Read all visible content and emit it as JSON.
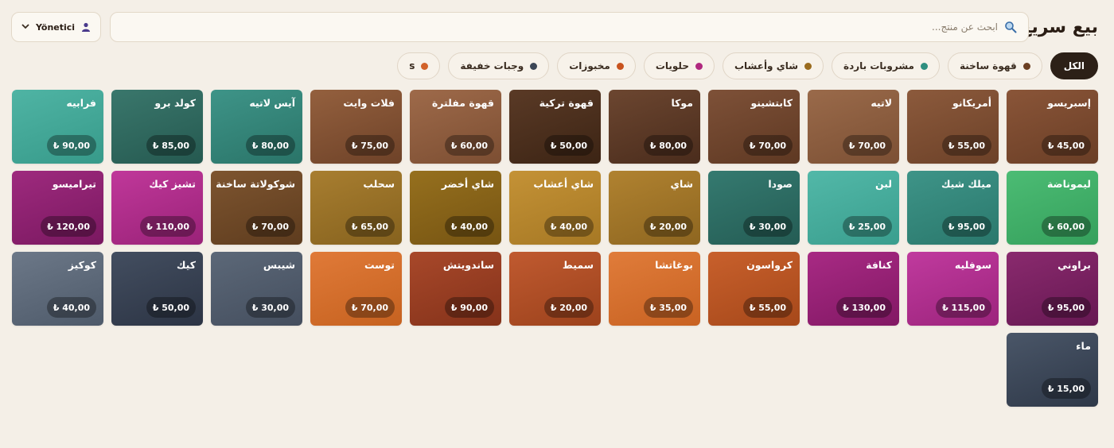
{
  "header": {
    "title": "بيع سريع",
    "search_placeholder": "ابحث عن منتج...",
    "user_label": "Yönetici"
  },
  "categories": [
    {
      "label": "الكل",
      "active": true,
      "color": ""
    },
    {
      "label": "قهوة ساخنة",
      "active": false,
      "color": "#6b3f22"
    },
    {
      "label": "مشروبات باردة",
      "active": false,
      "color": "#2f8f80"
    },
    {
      "label": "شاي وأعشاب",
      "active": false,
      "color": "#9a6b1e"
    },
    {
      "label": "حلويات",
      "active": false,
      "color": "#b0287f"
    },
    {
      "label": "مخبوزات",
      "active": false,
      "color": "#c8531f"
    },
    {
      "label": "وجبات خفيفة",
      "active": false,
      "color": "#3c4656"
    },
    {
      "label": "s",
      "active": false,
      "color": "#d2622a"
    }
  ],
  "products": [
    {
      "name": "إسبريسو",
      "price": "₺ 45,00",
      "c1": "#8a5538",
      "c2": "#6a3e26"
    },
    {
      "name": "أمريكانو",
      "price": "₺ 55,00",
      "c1": "#8c5a3c",
      "c2": "#6c4128"
    },
    {
      "name": "لاتيه",
      "price": "₺ 70,00",
      "c1": "#9a6a4a",
      "c2": "#7c5034"
    },
    {
      "name": "كابتشينو",
      "price": "₺ 70,00",
      "c1": "#7e5138",
      "c2": "#5e3822"
    },
    {
      "name": "موكا",
      "price": "₺ 80,00",
      "c1": "#6c4630",
      "c2": "#4a2c1c"
    },
    {
      "name": "قهوة تركية",
      "price": "₺ 50,00",
      "c1": "#5a3a26",
      "c2": "#3c2414"
    },
    {
      "name": "قهوة مفلترة",
      "price": "₺ 60,00",
      "c1": "#9e6a4a",
      "c2": "#7c4e32"
    },
    {
      "name": "فلات وايت",
      "price": "₺ 75,00",
      "c1": "#94603e",
      "c2": "#6e4228"
    },
    {
      "name": "آيس لاتيه",
      "price": "₺ 80,00",
      "c1": "#3e9488",
      "c2": "#2a7468"
    },
    {
      "name": "كولد برو",
      "price": "₺ 85,00",
      "c1": "#3a776c",
      "c2": "#255950"
    },
    {
      "name": "فرابيه",
      "price": "₺ 90,00",
      "c1": "#4fb4a4",
      "c2": "#379a8a"
    },
    {
      "name": "ليموناضة",
      "price": "₺ 60,00",
      "c1": "#4cbc74",
      "c2": "#35a05c"
    },
    {
      "name": "ميلك شيك",
      "price": "₺ 95,00",
      "c1": "#3e9488",
      "c2": "#2a786c"
    },
    {
      "name": "لبن",
      "price": "₺ 25,00",
      "c1": "#52b8a8",
      "c2": "#3a9e8e"
    },
    {
      "name": "صودا",
      "price": "₺ 30,00",
      "c1": "#357a70",
      "c2": "#245c54"
    },
    {
      "name": "شاي",
      "price": "₺ 20,00",
      "c1": "#b08230",
      "c2": "#8e6620"
    },
    {
      "name": "شاي أعشاب",
      "price": "₺ 40,00",
      "c1": "#c49236",
      "c2": "#a67824"
    },
    {
      "name": "شاي أخضر",
      "price": "₺ 40,00",
      "c1": "#96701e",
      "c2": "#765412"
    },
    {
      "name": "سحلب",
      "price": "₺ 65,00",
      "c1": "#a87e30",
      "c2": "#86621e"
    },
    {
      "name": "شوكولاتة ساخنة",
      "price": "₺ 70,00",
      "c1": "#7e5530",
      "c2": "#5e3c1e"
    },
    {
      "name": "تشيز كيك",
      "price": "₺ 110,00",
      "c1": "#c0389a",
      "c2": "#9a2278"
    },
    {
      "name": "تيراميسو",
      "price": "₺ 120,00",
      "c1": "#9e2a7e",
      "c2": "#7a1860"
    },
    {
      "name": "براوني",
      "price": "₺ 95,00",
      "c1": "#8a2a6e",
      "c2": "#661852"
    },
    {
      "name": "سوفليه",
      "price": "₺ 115,00",
      "c1": "#c03a9e",
      "c2": "#9c247c"
    },
    {
      "name": "كنافة",
      "price": "₺ 130,00",
      "c1": "#a82a84",
      "c2": "#821864"
    },
    {
      "name": "كرواسون",
      "price": "₺ 55,00",
      "c1": "#c8602c",
      "c2": "#a6481a"
    },
    {
      "name": "بوغاتشا",
      "price": "₺ 35,00",
      "c1": "#e07c3a",
      "c2": "#c86222"
    },
    {
      "name": "سميط",
      "price": "₺ 20,00",
      "c1": "#c05a30",
      "c2": "#9c421c"
    },
    {
      "name": "ساندويتش",
      "price": "₺ 90,00",
      "c1": "#a8482a",
      "c2": "#84321a"
    },
    {
      "name": "توست",
      "price": "₺ 70,00",
      "c1": "#e07a38",
      "c2": "#c66220"
    },
    {
      "name": "شيبس",
      "price": "₺ 30,00",
      "c1": "#5c6878",
      "c2": "#444e5e"
    },
    {
      "name": "كيك",
      "price": "₺ 50,00",
      "c1": "#434e60",
      "c2": "#2c3444"
    },
    {
      "name": "كوكيز",
      "price": "₺ 40,00",
      "c1": "#6c7888",
      "c2": "#4e5a6a"
    },
    {
      "name": "ماء",
      "price": "₺ 15,00",
      "c1": "#4a5668",
      "c2": "#2e3848"
    }
  ]
}
